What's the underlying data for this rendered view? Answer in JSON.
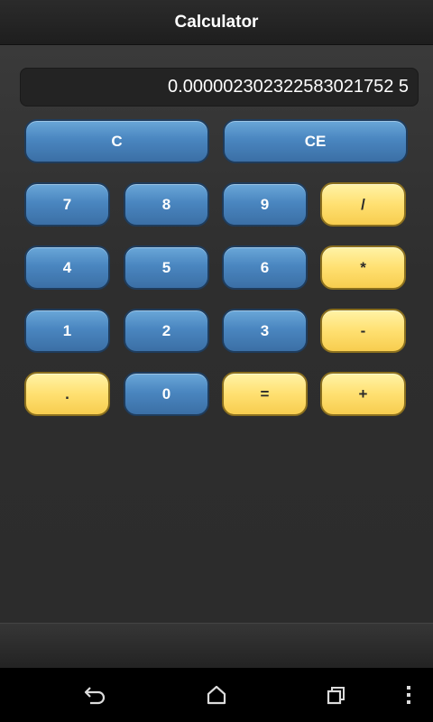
{
  "app": {
    "title": "Calculator"
  },
  "display": {
    "value": "0.000002302322583021752 5"
  },
  "buttons": {
    "clear": "C",
    "clear_entry": "CE",
    "seven": "7",
    "eight": "8",
    "nine": "9",
    "divide": "/",
    "four": "4",
    "five": "5",
    "six": "6",
    "multiply": "*",
    "one": "1",
    "two": "2",
    "three": "3",
    "subtract": "-",
    "decimal": ".",
    "zero": "0",
    "equals": "=",
    "add": "+"
  },
  "colors": {
    "blue_button": "#4a86c0",
    "yellow_button": "#ffe071",
    "background": "#2e2e2e"
  },
  "nav": {
    "icons": [
      "back-icon",
      "home-icon",
      "recent-apps-icon",
      "overflow-menu-icon"
    ]
  }
}
